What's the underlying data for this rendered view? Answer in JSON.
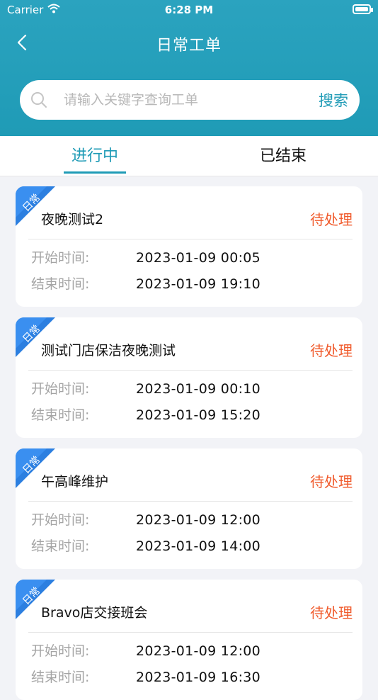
{
  "status_bar": {
    "carrier": "Carrier",
    "time": "6:28 PM"
  },
  "nav": {
    "title": "日常工单"
  },
  "search": {
    "placeholder": "请输入关键字查询工单",
    "button_label": "搜索"
  },
  "tabs": [
    {
      "label": "进行中",
      "active": true
    },
    {
      "label": "已结束",
      "active": false
    }
  ],
  "colors": {
    "accent": "#1f9bb6",
    "status": "#f05a2b",
    "corner_blue": "#2c7fe0"
  },
  "labels": {
    "start": "开始时间:",
    "end": "结束时间:"
  },
  "cards": [
    {
      "tag": "日常",
      "title": "夜晚测试2",
      "status": "待处理",
      "start": "2023-01-09 00:05",
      "end": "2023-01-09 19:10"
    },
    {
      "tag": "日常",
      "title": "测试门店保洁夜晚测试",
      "status": "待处理",
      "start": "2023-01-09 00:10",
      "end": "2023-01-09 15:20"
    },
    {
      "tag": "日常",
      "title": "午高峰维护",
      "status": "待处理",
      "start": "2023-01-09 12:00",
      "end": "2023-01-09 14:00"
    },
    {
      "tag": "日常",
      "title": "Bravo店交接班会",
      "status": "待处理",
      "start": "2023-01-09 12:00",
      "end": "2023-01-09 16:30"
    }
  ]
}
